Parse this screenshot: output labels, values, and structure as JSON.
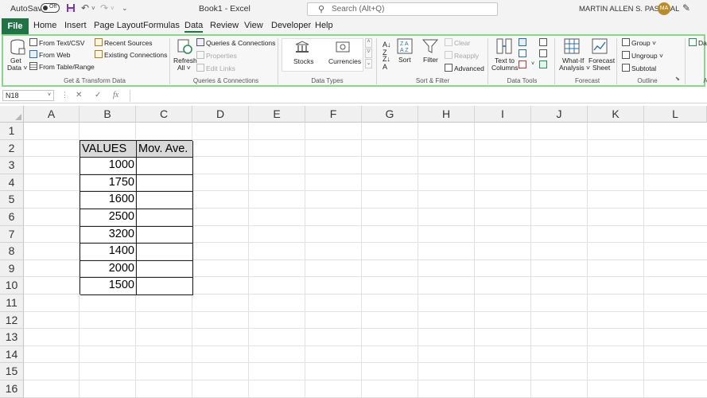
{
  "titlebar": {
    "autosave_label": "AutoSave",
    "autosave_state": "Off",
    "title": "Book1  -  Excel",
    "search_placeholder": "Search (Alt+Q)",
    "user_name": "MARTIN ALLEN S. PASCUAL",
    "user_initials": "MA"
  },
  "tabs": [
    "File",
    "Home",
    "Insert",
    "Page Layout",
    "Formulas",
    "Data",
    "Review",
    "View",
    "Developer",
    "Help"
  ],
  "active_tab": "Data",
  "ribbon": {
    "get_data": "Get Data",
    "get_data_l1": "Get",
    "get_data_l2": "Data ˅",
    "from_text_csv": "From Text/CSV",
    "from_web": "From Web",
    "from_table_range": "From Table/Range",
    "recent_sources": "Recent Sources",
    "existing_connections": "Existing Connections",
    "group_get_transform": "Get & Transform Data",
    "refresh_l1": "Refresh",
    "refresh_l2": "All ˅",
    "queries_connections": "Queries & Connections",
    "properties": "Properties",
    "edit_links": "Edit Links",
    "group_queries": "Queries & Connections",
    "stocks": "Stocks",
    "currencies": "Currencies",
    "group_data_types": "Data Types",
    "sort": "Sort",
    "filter": "Filter",
    "clear": "Clear",
    "reapply": "Reapply",
    "advanced": "Advanced",
    "group_sort_filter": "Sort & Filter",
    "text_to_l1": "Text to",
    "text_to_l2": "Columns",
    "group_data_tools": "Data Tools",
    "whatif_l1": "What-If",
    "whatif_l2": "Analysis ˅",
    "forecast_l1": "Forecast",
    "forecast_l2": "Sheet",
    "group_forecast": "Forecast",
    "group_btn": "Group",
    "ungroup_btn": "Ungroup",
    "subtotal": "Subtotal",
    "group_outline": "Outline",
    "right_cut": "Dat",
    "right_cut_group": "A"
  },
  "formula_bar": {
    "name_box": "N18",
    "formula": ""
  },
  "grid": {
    "columns": [
      "A",
      "B",
      "C",
      "D",
      "E",
      "F",
      "G",
      "H",
      "I",
      "J",
      "K",
      "L"
    ],
    "rows": [
      "1",
      "2",
      "3",
      "4",
      "5",
      "6",
      "7",
      "8",
      "9",
      "10",
      "11",
      "12",
      "13",
      "14",
      "15",
      "16"
    ],
    "header_b": "VALUES",
    "header_c": "Mov. Ave.",
    "values": [
      "1000",
      "1750",
      "1600",
      "2500",
      "3200",
      "1400",
      "2000",
      "1500"
    ]
  }
}
